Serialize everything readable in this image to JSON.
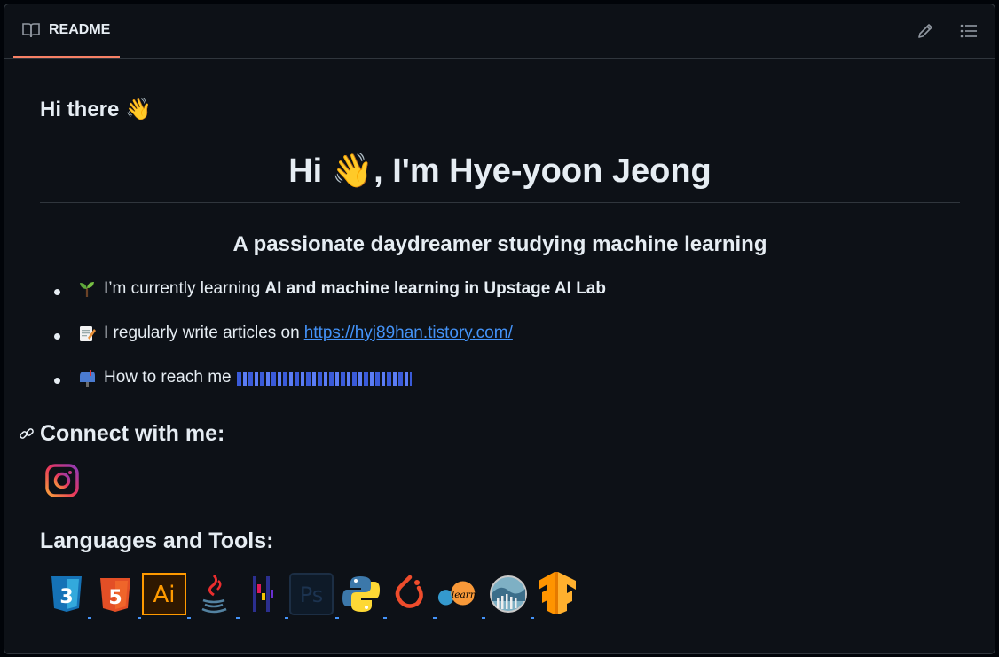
{
  "header": {
    "tab_label": "README",
    "icons": [
      "book-icon",
      "pencil-icon",
      "list-icon"
    ]
  },
  "readme": {
    "greeting": "Hi there 👋",
    "title": "Hi 👋, I'm Hye-yoon Jeong",
    "subtitle": "A passionate daydreamer studying machine learning",
    "bullets": [
      {
        "emoji": "seedling-icon",
        "text": "I’m currently learning",
        "bold": "AI and machine learning in Upstage AI Lab"
      },
      {
        "emoji": "memo-icon",
        "text": "I regularly write articles on",
        "link": "https://hyj89han.tistory.com/"
      },
      {
        "emoji": "mailbox-icon",
        "text": "How to reach me"
      }
    ],
    "connect_heading": "Connect with me:",
    "connect_icons": [
      "instagram-icon"
    ],
    "tools_heading": "Languages and Tools:",
    "tools": [
      {
        "name": "css3-icon",
        "label": "3"
      },
      {
        "name": "html5-icon",
        "label": "5"
      },
      {
        "name": "illustrator-icon",
        "label": "Ai"
      },
      {
        "name": "java-icon",
        "label": ""
      },
      {
        "name": "dev-icon",
        "label": ""
      },
      {
        "name": "photoshop-icon",
        "label": "Ps"
      },
      {
        "name": "python-icon",
        "label": ""
      },
      {
        "name": "pytorch-icon",
        "label": ""
      },
      {
        "name": "scikit-learn-icon",
        "label": "learn"
      },
      {
        "name": "seaborn-icon",
        "label": ""
      },
      {
        "name": "tensorflow-icon",
        "label": ""
      }
    ]
  },
  "colors": {
    "background": "#0d1117",
    "border": "#30363d",
    "text": "#e6edf3",
    "link": "#4493f8",
    "tab_underline": "#f78166"
  }
}
